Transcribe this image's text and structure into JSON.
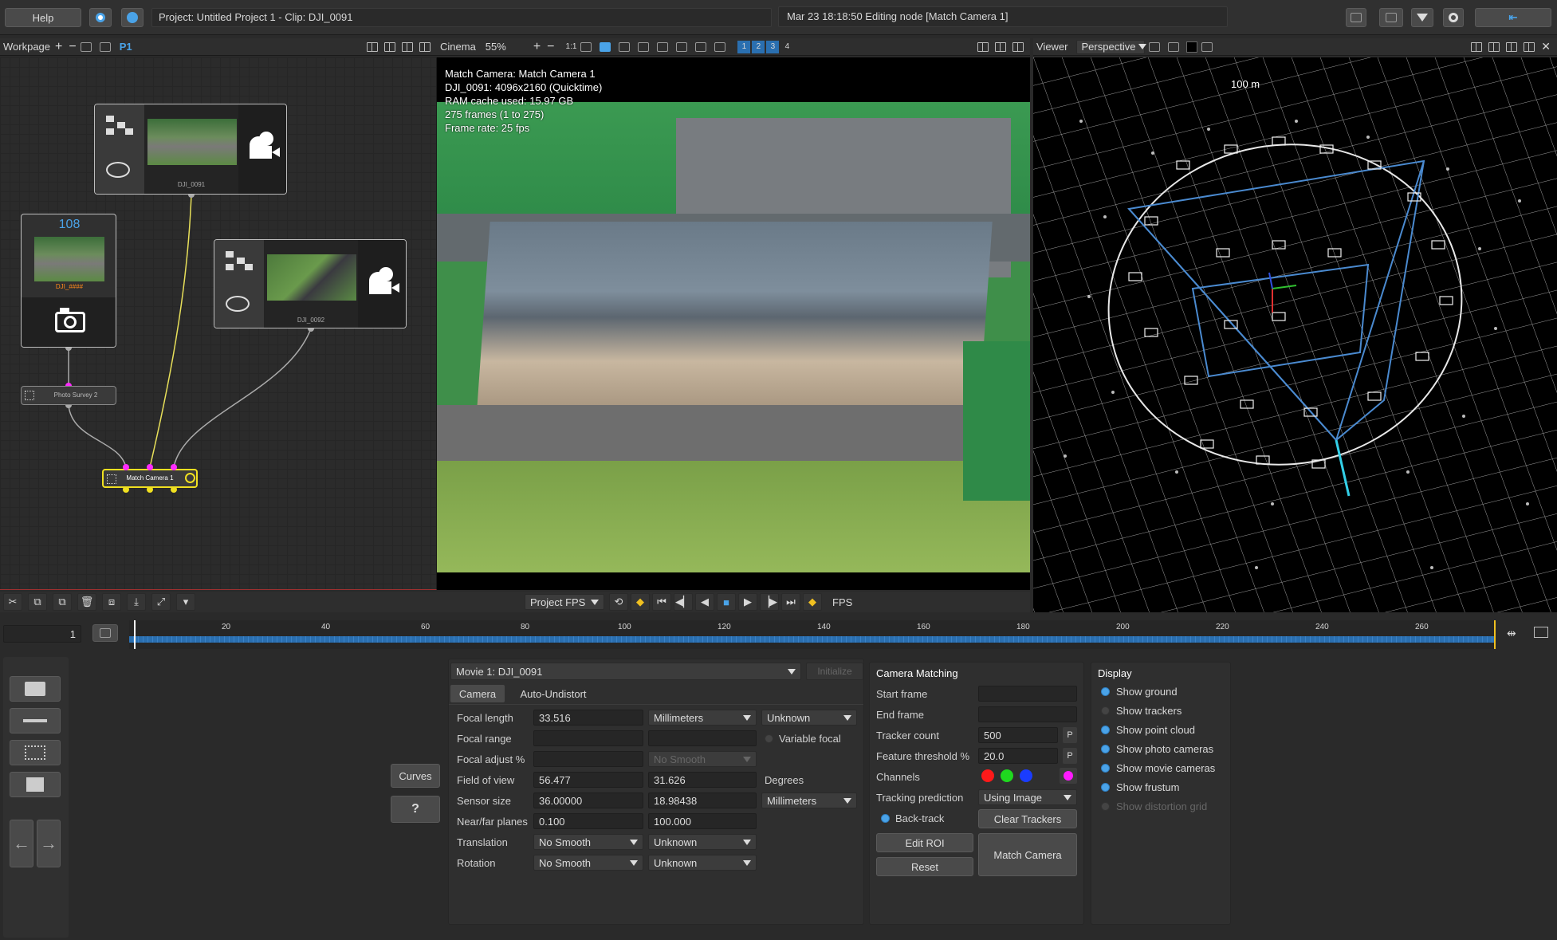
{
  "topbar": {
    "help_label": "Help",
    "project_title": "Project: Untitled Project 1 - Clip: DJI_0091",
    "status_message": "Mar 23 18:18:50 Editing node [Match Camera 1]"
  },
  "workpage": {
    "label": "Workpage",
    "page_tab": "P1",
    "nodes": {
      "movie1_label": "DJI_0091",
      "movie2_label": "DJI_0092",
      "photo_count": "108",
      "photo_label": "DJI_####",
      "photo_survey_label": "Photo Survey 2",
      "match_camera_label": "Match Camera 1"
    }
  },
  "cinema": {
    "label": "Cinema",
    "zoom": "55%",
    "ratio_label": "1:1",
    "views": [
      "1",
      "2",
      "3",
      "4"
    ],
    "overlay": {
      "line1": "Match Camera: Match Camera 1",
      "line2": "DJI_0091: 4096x2160 (Quicktime)",
      "line3": "RAM cache used: 15.97 GB",
      "line4": "275 frames (1 to 275)",
      "line5": "Frame rate: 25 fps"
    },
    "fps_select": "Project FPS",
    "fps_label": "FPS"
  },
  "viewer": {
    "label": "Viewer",
    "mode": "Perspective",
    "scale_label": "100 m"
  },
  "timeline": {
    "current_frame": "1",
    "ticks": [
      "20",
      "40",
      "60",
      "80",
      "100",
      "120",
      "140",
      "160",
      "180",
      "200",
      "220",
      "240",
      "260"
    ]
  },
  "sidepanel": {
    "curves_label": "Curves",
    "help_icon": "?"
  },
  "camera_panel": {
    "movie_select": "Movie 1: DJI_0091",
    "initialize_label": "Initialize",
    "tabs": [
      "Camera",
      "Auto-Undistort"
    ],
    "rows": {
      "focal_length": {
        "label": "Focal length",
        "value": "33.516",
        "unit": "Millimeters",
        "status": "Unknown"
      },
      "focal_range": {
        "label": "Focal range",
        "variable_focal": "Variable focal"
      },
      "focal_adjust": {
        "label": "Focal adjust %",
        "smooth": "No Smooth"
      },
      "field_of_view": {
        "label": "Field of view",
        "h": "56.477",
        "v": "31.626",
        "unit": "Degrees"
      },
      "sensor_size": {
        "label": "Sensor size",
        "w": "36.00000",
        "h": "18.98438",
        "unit": "Millimeters"
      },
      "near_far": {
        "label": "Near/far planes",
        "near": "0.100",
        "far": "100.000"
      },
      "translation": {
        "label": "Translation",
        "smooth": "No Smooth",
        "status": "Unknown"
      },
      "rotation": {
        "label": "Rotation",
        "smooth": "No Smooth",
        "status": "Unknown"
      }
    }
  },
  "matching_panel": {
    "title": "Camera Matching",
    "start_frame": "Start frame",
    "end_frame": "End frame",
    "tracker_count_label": "Tracker count",
    "tracker_count": "500",
    "feature_threshold_label": "Feature threshold %",
    "feature_threshold": "20.0",
    "p_label": "P",
    "channels_label": "Channels",
    "channel_colors": [
      "#ff1a1a",
      "#1fd81f",
      "#1a3cff",
      "#ff1aff"
    ],
    "tracking_prediction_label": "Tracking prediction",
    "tracking_prediction": "Using Image",
    "back_track": "Back-track",
    "clear_trackers": "Clear Trackers",
    "edit_roi": "Edit ROI",
    "reset": "Reset",
    "match_camera": "Match Camera"
  },
  "display_panel": {
    "title": "Display",
    "items": [
      {
        "label": "Show ground",
        "on": true
      },
      {
        "label": "Show trackers",
        "on": false
      },
      {
        "label": "Show point cloud",
        "on": true
      },
      {
        "label": "Show photo cameras",
        "on": true
      },
      {
        "label": "Show movie cameras",
        "on": true
      },
      {
        "label": "Show frustum",
        "on": true
      },
      {
        "label": "Show distortion grid",
        "on": false
      }
    ]
  },
  "colors": {
    "accent": "#4aa3e8",
    "selection": "#f0e020",
    "magenta": "#ff2aff"
  }
}
